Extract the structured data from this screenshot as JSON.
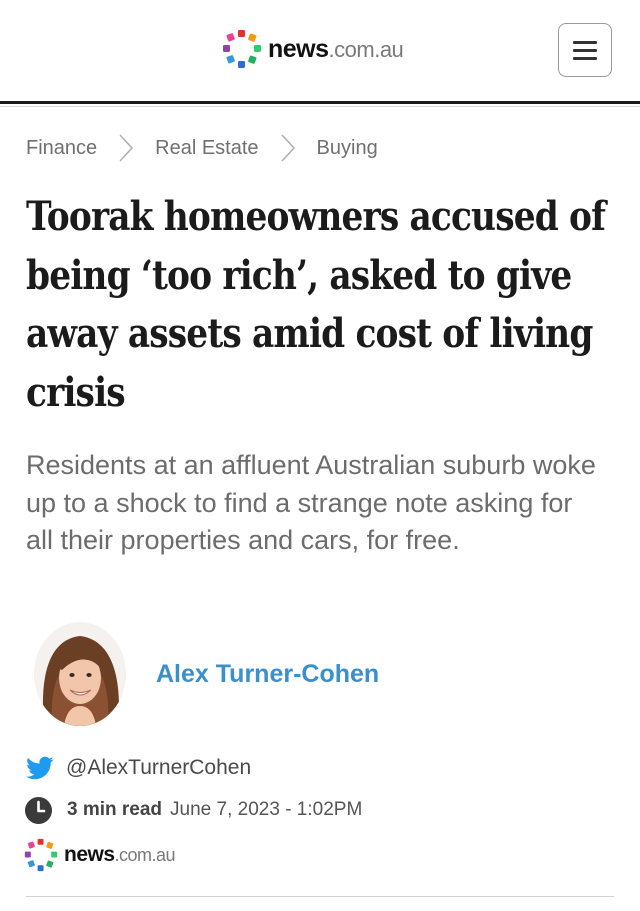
{
  "header": {
    "logo": {
      "name": "news",
      "domain": ".com.au",
      "mark_colors": [
        "#e4322b",
        "#f39c12",
        "#2ecc71",
        "#27ae60",
        "#3498db",
        "#2c6fd1",
        "#8e44ad",
        "#e84393"
      ]
    },
    "menu_icon": "hamburger-menu-icon"
  },
  "breadcrumb": {
    "items": [
      "Finance",
      "Real Estate",
      "Buying"
    ],
    "separator_icon": "chevron-right-icon"
  },
  "article": {
    "headline": "Toorak homeowners accused of being ‘too rich’, asked to give away assets amid cost of living crisis",
    "standfirst": "Residents at an affluent Australian suburb woke up to a shock to find a strange note asking for all their properties and cars, for free.",
    "author": {
      "name": "Alex Turner-Cohen",
      "twitter_handle": "@AlexTurnerCohen",
      "name_color": "#3a8fcd"
    },
    "read_time": "3 min read",
    "published": "June 7, 2023 - 1:02PM",
    "source": {
      "name": "news",
      "domain": ".com.au"
    }
  },
  "colors": {
    "twitter": "#1d9bf0",
    "text_primary": "#1b1b1b",
    "text_secondary": "#6c6c6c"
  }
}
